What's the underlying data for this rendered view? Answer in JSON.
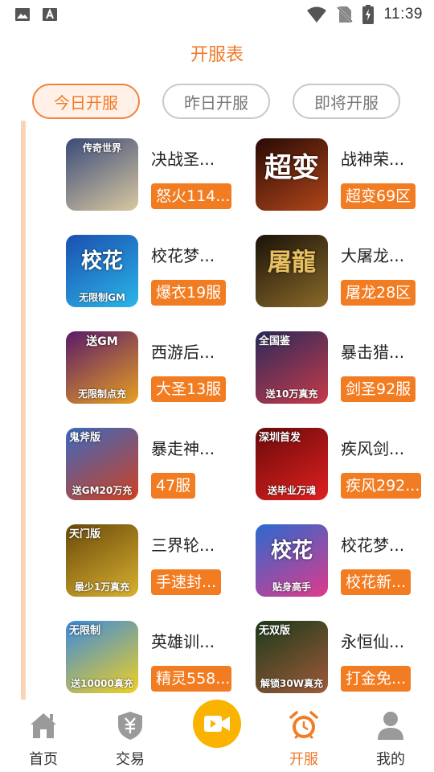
{
  "status_bar": {
    "time": "11:39",
    "left_icons": [
      "image-icon",
      "a-icon"
    ],
    "right_icons": [
      "wifi-icon",
      "no-sim-icon",
      "battery-charging-icon"
    ]
  },
  "header": {
    "title": "开服表"
  },
  "tabs": [
    {
      "label": "今日开服",
      "active": true
    },
    {
      "label": "昨日开服",
      "active": false
    },
    {
      "label": "即将开服",
      "active": false
    }
  ],
  "games": [
    {
      "name": "决战圣...",
      "server": "怒火114...",
      "art_top": "传奇世界",
      "art_bottom": "",
      "colors": [
        "#3a4a7a",
        "#d9c9a0"
      ]
    },
    {
      "name": "战神荣...",
      "server": "超变69区",
      "art_top": "超变",
      "art_bottom": "",
      "colors": [
        "#2a0a05",
        "#b0461a"
      ]
    },
    {
      "name": "校花梦...",
      "server": "爆衣19服",
      "art_top": "校花",
      "art_bottom": "无限制GM",
      "colors": [
        "#1a4fb0",
        "#2bb6e8"
      ]
    },
    {
      "name": "大屠龙...",
      "server": "屠龙28区",
      "art_top": "屠龍",
      "art_bottom": "",
      "colors": [
        "#1a1208",
        "#8a6a2a"
      ]
    },
    {
      "name": "西游后...",
      "server": "大圣13服",
      "art_top": "送GM",
      "art_bottom": "无限制点充",
      "colors": [
        "#5a1a6a",
        "#e8a020"
      ]
    },
    {
      "name": "暴击猎...",
      "server": "剑圣92服",
      "art_top": "全国鉴",
      "art_bottom": "送10万真充",
      "colors": [
        "#2a2a5a",
        "#c83a4a"
      ]
    },
    {
      "name": "暴走神...",
      "server": "47服",
      "art_top": "鬼斧版",
      "art_bottom": "送GM20万充",
      "colors": [
        "#3a6ac0",
        "#d04020"
      ]
    },
    {
      "name": "疾风剑...",
      "server": "疾风292...",
      "art_top": "深圳首发",
      "art_bottom": "送毕业万魂",
      "colors": [
        "#6a0a0a",
        "#e02020"
      ]
    },
    {
      "name": "三界轮...",
      "server": "手速封...",
      "art_top": "天门版",
      "art_bottom": "最少1万真充",
      "colors": [
        "#6a4a0a",
        "#d8b030"
      ]
    },
    {
      "name": "校花梦...",
      "server": "校花新...",
      "art_top": "校花",
      "art_bottom": "贴身高手",
      "colors": [
        "#2a6ad0",
        "#e03a8a"
      ]
    },
    {
      "name": "英雄训...",
      "server": "精灵558...",
      "art_top": "无限制",
      "art_bottom": "送10000真充",
      "colors": [
        "#3a8ae0",
        "#f0d020"
      ]
    },
    {
      "name": "永恒仙...",
      "server": "打金免...",
      "art_top": "无双版",
      "art_bottom": "解锁30W真充",
      "colors": [
        "#1a3a1a",
        "#a05a3a"
      ]
    }
  ],
  "bottom_nav": [
    {
      "label": "首页",
      "icon": "home-icon",
      "active": false
    },
    {
      "label": "交易",
      "icon": "shield-yen-icon",
      "active": false
    },
    {
      "label": "",
      "icon": "video-icon",
      "active": false
    },
    {
      "label": "开服",
      "icon": "alarm-clock-icon",
      "active": true
    },
    {
      "label": "我的",
      "icon": "user-icon",
      "active": false
    }
  ],
  "colors": {
    "accent": "#F27C22",
    "title": "#F07A2A",
    "video": "#F9B300",
    "timeline": "#FBD3B5"
  }
}
